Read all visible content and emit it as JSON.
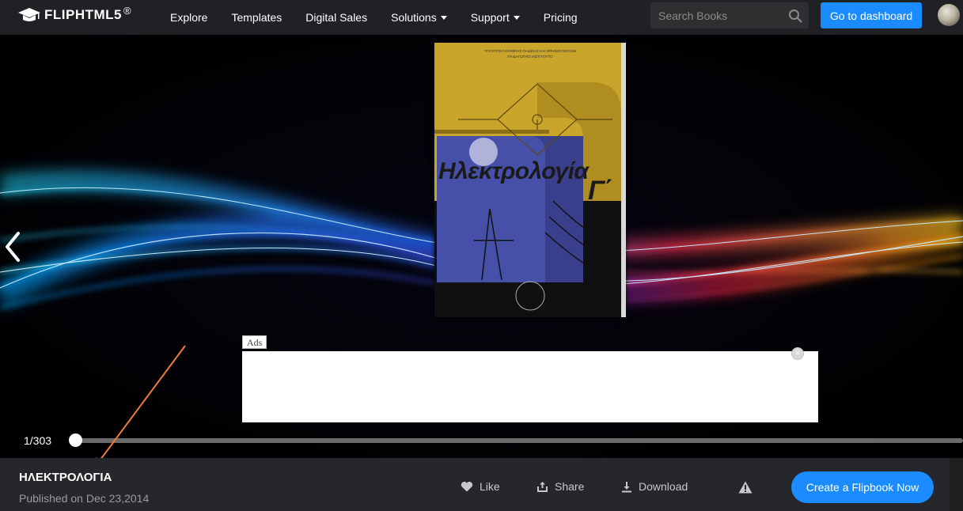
{
  "header": {
    "logo_text": "FLIPHTML5",
    "logo_reg": "®",
    "nav": [
      {
        "label": "Explore",
        "dropdown": false
      },
      {
        "label": "Templates",
        "dropdown": false
      },
      {
        "label": "Digital Sales",
        "dropdown": false
      },
      {
        "label": "Solutions",
        "dropdown": true
      },
      {
        "label": "Support",
        "dropdown": true
      },
      {
        "label": "Pricing",
        "dropdown": false
      }
    ],
    "search_placeholder": "Search Books",
    "dashboard_button": "Go to dashboard"
  },
  "viewer": {
    "ads_label": "Ads",
    "ads_close": "×",
    "page_indicator": "1/303",
    "current_page": 1,
    "total_pages": 303
  },
  "book_info": {
    "title": "ΗΛΕΚΤΡΟΛΟΓΙΑ",
    "published": "Published on Dec 23,2014"
  },
  "actions": {
    "like": "Like",
    "share": "Share",
    "download": "Download",
    "create": "Create a Flipbook Now"
  },
  "colors": {
    "header_bg": "#202124",
    "accent": "#1a8cff",
    "bottom_bar_bg": "#26272a"
  }
}
